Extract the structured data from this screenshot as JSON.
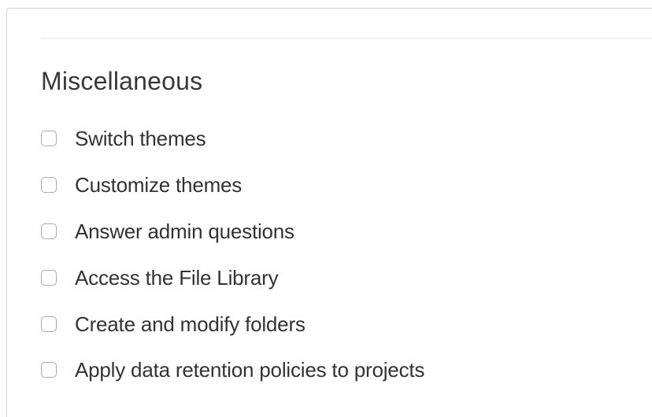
{
  "section": {
    "title": "Miscellaneous"
  },
  "options": [
    {
      "label": "Switch themes",
      "checked": false
    },
    {
      "label": "Customize themes",
      "checked": false
    },
    {
      "label": "Answer admin questions",
      "checked": false
    },
    {
      "label": "Access the File Library",
      "checked": false
    },
    {
      "label": "Create and modify folders",
      "checked": false
    },
    {
      "label": "Apply data retention policies to projects",
      "checked": false
    }
  ]
}
